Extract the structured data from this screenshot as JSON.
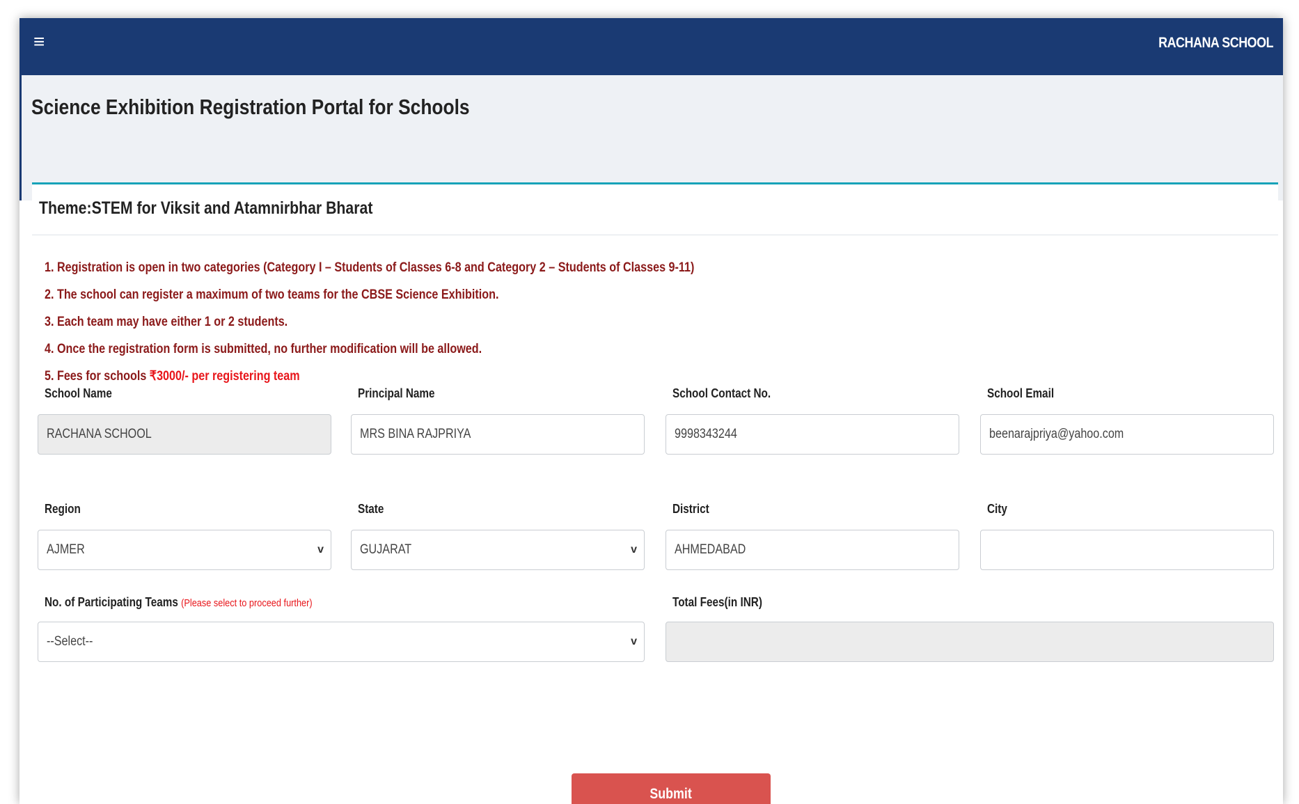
{
  "topbar": {
    "menu_icon": "≡",
    "school_name": "RACHANA SCHOOL"
  },
  "page": {
    "title": "Science Exhibition Registration Portal for Schools"
  },
  "card": {
    "theme": "Theme:STEM for Viksit and Atamnirbhar Bharat",
    "notes": [
      "1. Registration is open in two categories (Category I – Students of Classes 6-8 and Category 2 – Students of Classes 9-11)",
      "2. The school can register a maximum of two teams for the CBSE Science Exhibition.",
      "3. Each team may have either 1 or 2 students.",
      "4. Once the registration form is submitted, no further modification will be allowed."
    ],
    "fee_note_prefix": "5. Fees for schools ",
    "fee_note_amount": "₹3000/- per registering team"
  },
  "form": {
    "school_name": {
      "label": "School Name",
      "value": "RACHANA SCHOOL"
    },
    "principal_name": {
      "label": "Principal Name",
      "value": "MRS BINA  RAJPRIYA"
    },
    "contact": {
      "label": "School Contact No.",
      "value": "9998343244"
    },
    "email": {
      "label": "School Email",
      "value": "beenarajpriya@yahoo.com"
    },
    "region": {
      "label": "Region",
      "value": "AJMER"
    },
    "state": {
      "label": "State",
      "value": "GUJARAT"
    },
    "district": {
      "label": "District",
      "value": "AHMEDABAD"
    },
    "city": {
      "label": "City",
      "value": ""
    },
    "teams": {
      "label": "No. of Participating Teams ",
      "hint": "(Please select to proceed further)",
      "value": "--Select--"
    },
    "total_fees": {
      "label": "Total Fees(in INR)",
      "value": ""
    },
    "submit_label": "Submit"
  },
  "icons": {
    "caret": "chevron-down-icon"
  }
}
